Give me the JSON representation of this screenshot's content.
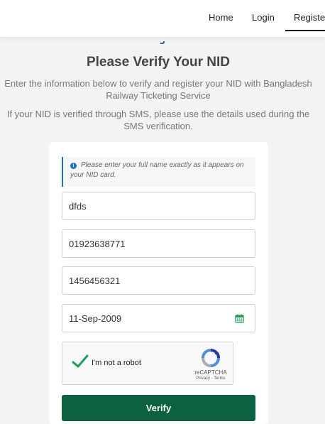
{
  "nav": {
    "home": "Home",
    "login": "Login",
    "register": "Register"
  },
  "page": {
    "title": "Please Verify Your NID",
    "intro": "Enter the information below to verify and register your NID with Bangladesh Railway Ticketing Service",
    "intro2": "If your NID is verified through SMS, please use the details used during the SMS verification."
  },
  "form": {
    "alert": "Please enter your full name exactly as it appears on your NID card.",
    "name_value": "dfds",
    "phone_value": "01923638771",
    "nid_value": "1456456321",
    "dob_value": "11-Sep-2009",
    "captcha_label": "I'm not a robot",
    "captcha_brand": "reCAPTCHA",
    "captcha_links": "Privacy - Terms",
    "verify_label": "Verify"
  },
  "colors": {
    "primary": "#0c6140",
    "info": "#1a73c8",
    "check": "#1e9e57"
  }
}
